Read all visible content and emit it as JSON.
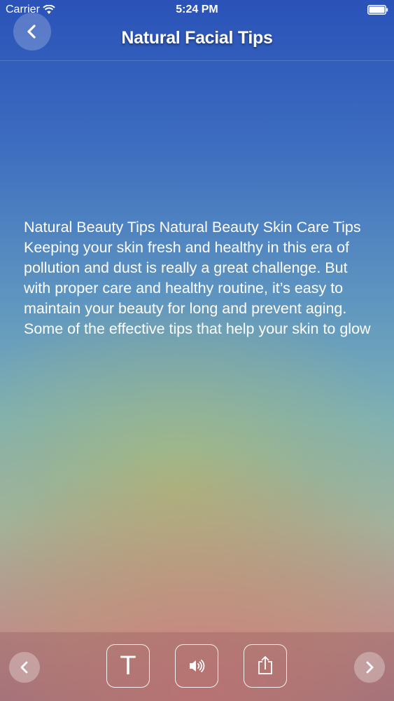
{
  "status_bar": {
    "carrier": "Carrier",
    "time": "5:24 PM"
  },
  "nav": {
    "title": "Natural Facial Tips"
  },
  "content": {
    "text": "Natural Beauty Tips Natural Beauty Skin Care Tips Keeping your skin fresh and healthy in this era of pollution and dust is really a great challenge. But with proper care and healthy routine, it’s easy to maintain your beauty for long and prevent aging. Some of the effective tips that help your skin to glow"
  },
  "toolbar": {
    "text_size_label": "T",
    "icons": [
      "chevron-left-icon",
      "text-size-icon",
      "speaker-icon",
      "share-icon",
      "chevron-right-icon"
    ]
  },
  "colors": {
    "top": "#2a52b8",
    "middle": "#7eb1b5",
    "bottom": "#b89292"
  }
}
